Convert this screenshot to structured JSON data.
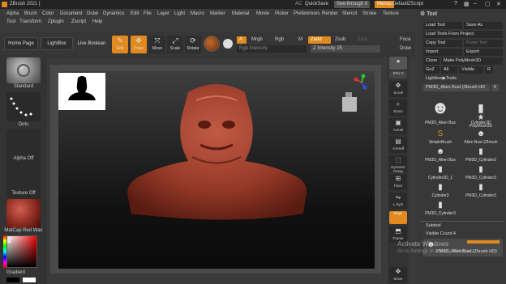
{
  "title": "ZBrush 2021 [",
  "titlebar": {
    "ac_label": "AC",
    "quicksave_label": "QuickSave",
    "seethrough_label": "See-through  0",
    "menus_label": "Menus",
    "defaultzscript_label": "DefaultZScript"
  },
  "menu_row1": [
    "Alpha",
    "Brush",
    "Color",
    "Document",
    "Draw",
    "Dynamics",
    "Edit",
    "File",
    "Layer",
    "Light",
    "Macro",
    "Marker",
    "Material",
    "Movie",
    "Picker",
    "Preferences",
    "Render",
    "Stencil",
    "Stroke",
    "Texture"
  ],
  "menu_row2": [
    "Tool",
    "Transform",
    "Zplugin",
    "Zscript",
    "Help"
  ],
  "shelf": {
    "home_page": "Home Page",
    "lightbox": "LightBox",
    "live_boolean": "Live Boolean",
    "edit": "Edit",
    "draw": "Draw",
    "move": "Move",
    "scale": "Scale",
    "rotate": "Rotate",
    "a_label": "A",
    "mrgb": "Mrgb",
    "rgb": "Rgb",
    "m": "M",
    "zadd": "Zadd",
    "zsub": "Zsub",
    "zcut": "Zcut",
    "rgb_intensity": "Rgb Intensity",
    "z_intensity": "Z Intensity 25",
    "focal": "Foca",
    "draw_size": "Draw"
  },
  "left_tray": {
    "brush_label": "Standard",
    "stroke_label": "Dots",
    "alpha_label": "Alpha Off",
    "texture_label": "Texture Off",
    "material_label": "MatCap Red Wax",
    "gradient_label": "Gradient"
  },
  "right_strip": [
    "BPR",
    "SPix 3",
    "Scroll",
    "Zoom",
    "Actual",
    "AAHalf",
    "Dynamic Persp",
    "Floor",
    "L.Sym",
    "Gxyz",
    "Frame",
    "Move"
  ],
  "tool_panel": {
    "title": "Tool",
    "load_tool": "Load Tool",
    "save_as": "Save As",
    "load_tools_from_project": "Load Tools From Project",
    "copy_tool": "Copy Tool",
    "paste_tool": "Paste Tool",
    "import": "Import",
    "export": "Export",
    "clone": "Clone",
    "make_polymesh": "Make PolyMesh3D",
    "goz": "GoZ",
    "all": "All",
    "visible": "Visible",
    "r": "R",
    "lightbox_tools": "Lightbox▶Tools",
    "current_tool": "PM3D_Alien Bust (Zbrush HD",
    "current_count": "5",
    "tools": [
      {
        "label": "PM3D_Alien Bus",
        "icon": "bust"
      },
      {
        "label": "Cylinder3D",
        "icon": "cylinder"
      },
      {
        "label": "PolyMesh3D",
        "icon": "star"
      },
      {
        "label": "SimpleBrush",
        "icon": "brush"
      },
      {
        "label": "Alien Bust (Zbrush",
        "icon": "bust"
      },
      {
        "label": "PM3D_Alien Bus",
        "icon": "bust"
      },
      {
        "label": "PM3D_Cylinder3",
        "icon": "cylinder"
      },
      {
        "label": "Cylinder3D_1",
        "icon": "cylinder"
      },
      {
        "label": "PM3D_Cylinder3",
        "icon": "cylinder"
      },
      {
        "label": "Cylinder3",
        "icon": "cylinder"
      },
      {
        "label": "PM3D_Cylinder3",
        "icon": "cylinder"
      },
      {
        "label": "PM3D_Cylinder3",
        "icon": "cylinder"
      }
    ],
    "subtool_title": "Subtool",
    "visible_count": "Visible Count 4",
    "subtool_item": "PM3D_Alien Bust (Zbrush HD)"
  },
  "watermark": {
    "line1": "Activate Windows",
    "line2": "Go to Settings to activate Windows."
  },
  "colors": {
    "orange": "#e08a20",
    "accent": "#f0a030",
    "clay": "#a04030"
  }
}
